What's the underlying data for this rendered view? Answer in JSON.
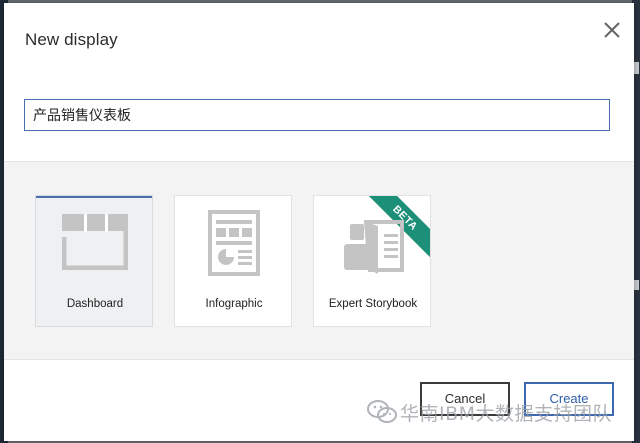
{
  "dialog": {
    "title": "New display",
    "close_icon": "close-icon"
  },
  "name_input": {
    "value": "产品销售仪表板"
  },
  "display_types": [
    {
      "label": "Dashboard",
      "icon": "dashboard-icon",
      "selected": true
    },
    {
      "label": "Infographic",
      "icon": "infographic-icon",
      "selected": false
    },
    {
      "label": "Expert Storybook",
      "icon": "storybook-icon",
      "selected": false,
      "badge": "BETA"
    }
  ],
  "footer": {
    "cancel_label": "Cancel",
    "create_label": "Create"
  },
  "watermark": {
    "text": "华南IBM大数据支持团队",
    "icon": "wechat-icon"
  },
  "colors": {
    "accent": "#4a6fb0",
    "beta_badge": "#1c8f78",
    "icon_gray": "#c4c4c4"
  }
}
